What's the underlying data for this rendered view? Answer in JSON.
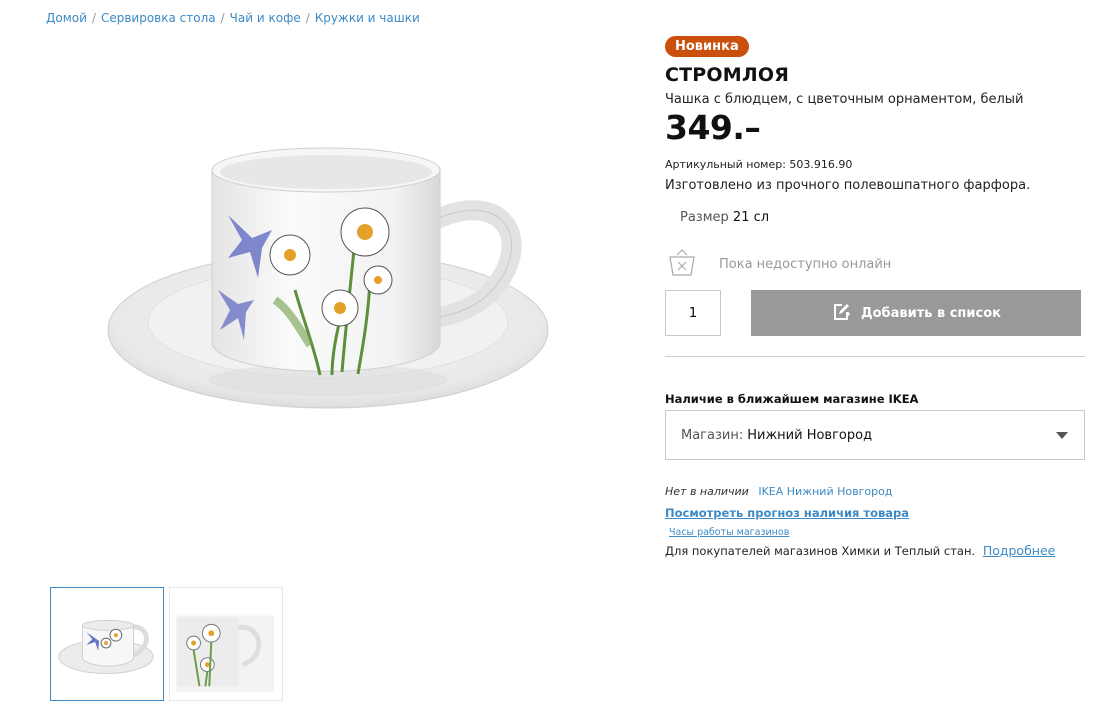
{
  "breadcrumb": [
    "Домой",
    "Сервировка стола",
    "Чай и кофе",
    "Кружки и чашки"
  ],
  "product": {
    "badge": "Новинка",
    "name": "СТРОМЛОЯ",
    "description": "Чашка с блюдцем, с цветочным орнаментом, белый",
    "price": "349.–",
    "article": "Артикульный номер: 503.916.90",
    "material": "Изготовлено из прочного полевошпатного фарфора.",
    "size_label": "Размер",
    "size_value": "21 сл"
  },
  "online": {
    "status_text": "Пока недоступно онлайн",
    "icon": "basket-unavailable-icon"
  },
  "purchase": {
    "quantity": "1",
    "add_to_list_label": "Добавить в список",
    "add_icon": "edit-list-icon"
  },
  "store": {
    "heading": "Наличие в ближайшем магазине IKEA",
    "select_prefix": "Магазин:",
    "select_value": "Нижний Новгород",
    "stock_status": "Нет в наличии",
    "stock_store": "IKEA Нижний Новгород",
    "forecast_link": "Посмотреть прогноз наличия товара",
    "hours_link": "Часы работы магазинов",
    "note": "Для покупателей магазинов Химки и Теплый стан.",
    "note_link": "Подробнее"
  },
  "colors": {
    "badge": "#c9500d",
    "link": "#3d8ac4",
    "button_disabled": "#999999"
  }
}
